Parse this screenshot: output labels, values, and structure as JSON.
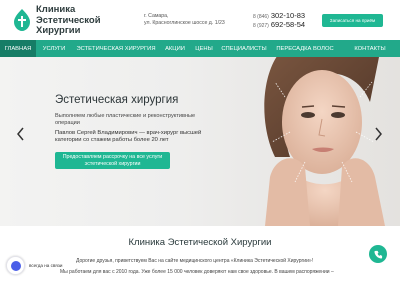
{
  "brand": {
    "line1": "Клиника",
    "line2": "Эстетической",
    "line3": "Хирургии",
    "accent": "#1fb793"
  },
  "header": {
    "address_line1": "г. Самара,",
    "address_line2": "ул. Красноглинское шоссе д. 1/23",
    "phone1_code": "8 (846)",
    "phone1_num": "302-10-83",
    "phone2_code": "8 (927)",
    "phone2_num": "692-58-54",
    "cta_label": "Записаться на приём"
  },
  "nav": {
    "items": [
      {
        "label": "ГЛАВНАЯ"
      },
      {
        "label": "УСЛУГИ"
      },
      {
        "label": "ЭСТЕТИЧЕСКАЯ ХИРУРГИЯ"
      },
      {
        "label": "АКЦИИ"
      },
      {
        "label": "ЦЕНЫ"
      },
      {
        "label": "СПЕЦИАЛИСТЫ"
      },
      {
        "label": "ПЕРЕСАДКА ВОЛОС"
      },
      {
        "label": "КОНТАКТЫ"
      }
    ]
  },
  "hero": {
    "title": "Эстетическая хирургия",
    "subtitle_line1": "Выполняем любые пластические и реконструктивные",
    "subtitle_line2": "операции",
    "doctor_line1": "Павлов Сергей Владимирович — врач-хирург высшей",
    "doctor_line2": "категории со стажем работы более 20 лет",
    "button_line1": "Предоставляем рассрочку на все услуги",
    "button_line2": "эстетической хирургии",
    "prev_icon": "chevron-left-icon",
    "next_icon": "chevron-right-icon"
  },
  "content": {
    "title": "Клиника Эстетической Хирургии",
    "para1": "Дорогие друзья, приветствуем Вас на сайте медицинского центра «Клиника Эстетической Хирургии»!",
    "para2": "Мы работаем для вас с 2010 года. Уже более 15 000 человек доверяют нам свое здоровье. В вашем распоряжении –"
  },
  "widgets": {
    "chat_label": "всегда на связи",
    "chat_icon": "chat-icon",
    "phone_icon": "phone-icon"
  }
}
